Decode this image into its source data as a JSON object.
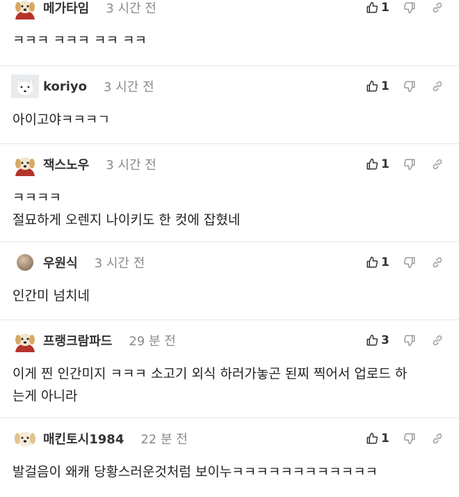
{
  "comments": [
    {
      "nickname": "메가타임",
      "time": "3 시간 전",
      "likes": "1",
      "avatar": "dog-avatar",
      "lines": [
        "ㅋㅋㅋ ㅋㅋㅋ ㅋㅋ ㅋㅋ"
      ]
    },
    {
      "nickname": "koriyo",
      "time": "3 시간 전",
      "likes": "1",
      "avatar": "white-fox-avatar",
      "lines": [
        "아이고야ㅋㅋㅋㄱ"
      ]
    },
    {
      "nickname": "잭스노우",
      "time": "3 시간 전",
      "likes": "1",
      "avatar": "dog-avatar",
      "lines": [
        "ㅋㅋㅋㅋ",
        "절묘하게 오렌지 나이키도 한 컷에 잡혔네"
      ]
    },
    {
      "nickname": "우원식",
      "time": "3 시간 전",
      "likes": "1",
      "avatar": "round-avatar",
      "lines": [
        "인간미 넘치네"
      ]
    },
    {
      "nickname": "프랭크람파드",
      "time": "29 분 전",
      "likes": "3",
      "avatar": "dog-avatar",
      "lines": [
        "이게 찐 인간미지 ㅋㅋㅋ 소고기 외식 하러가놓곤 된찌 찍어서 업로드 하",
        "는게 아니라"
      ]
    },
    {
      "nickname": "매킨토시1984",
      "time": "22 분 전",
      "likes": "1",
      "avatar": "puppy-avatar",
      "lines": [
        "발걸음이 왜캐 당황스러운것처럼 보이누ㅋㅋㅋㅋㅋㅋㅋㅋㅋㅋㅋㅋ"
      ]
    }
  ]
}
